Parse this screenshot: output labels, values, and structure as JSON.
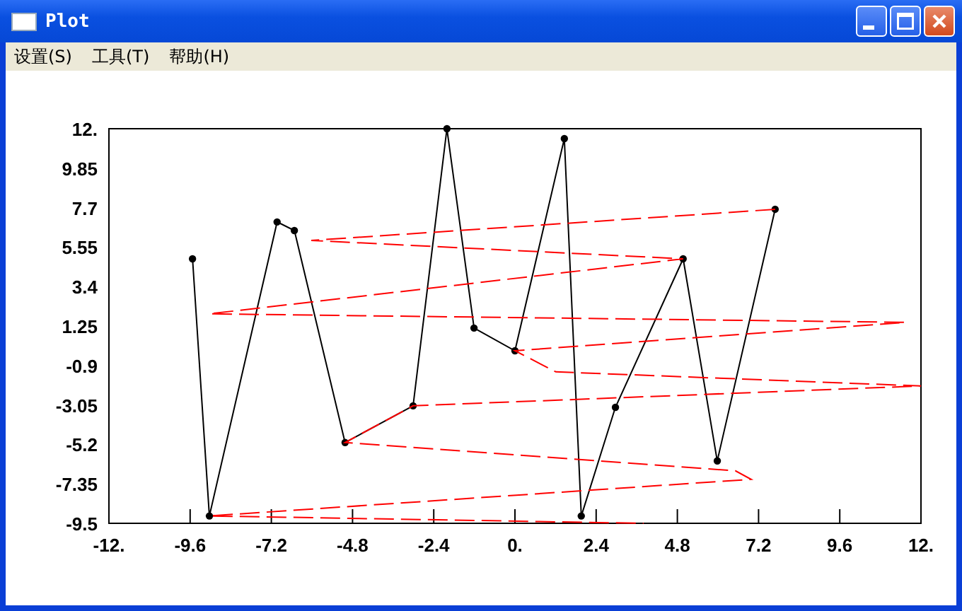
{
  "window": {
    "title": "Plot"
  },
  "menu": [
    {
      "label": "设置(S)"
    },
    {
      "label": "工具(T)"
    },
    {
      "label": "帮助(H)"
    }
  ],
  "plot": {
    "chart_data": {
      "type": "line",
      "xlim": [
        -12,
        12
      ],
      "ylim": [
        -9.5,
        12
      ],
      "xticks": [
        {
          "value": -12,
          "label": "-12."
        },
        {
          "value": -9.6,
          "label": "-9.6"
        },
        {
          "value": -7.2,
          "label": "-7.2"
        },
        {
          "value": -4.8,
          "label": "-4.8"
        },
        {
          "value": -2.4,
          "label": "-2.4"
        },
        {
          "value": 0,
          "label": "0."
        },
        {
          "value": 2.4,
          "label": "2.4"
        },
        {
          "value": 4.8,
          "label": "4.8"
        },
        {
          "value": 7.2,
          "label": "7.2"
        },
        {
          "value": 9.6,
          "label": "9.6"
        },
        {
          "value": 12,
          "label": "12."
        }
      ],
      "yticks": [
        {
          "value": 12,
          "label": "12."
        },
        {
          "value": 9.85,
          "label": "9.85"
        },
        {
          "value": 7.7,
          "label": "7.7"
        },
        {
          "value": 5.55,
          "label": "5.55"
        },
        {
          "value": 3.4,
          "label": "3.4"
        },
        {
          "value": 1.25,
          "label": "1.25"
        },
        {
          "value": -0.9,
          "label": "-0.9"
        },
        {
          "value": -3.05,
          "label": "-3.05"
        },
        {
          "value": -5.2,
          "label": "-5.2"
        },
        {
          "value": -7.35,
          "label": "-7.35"
        },
        {
          "value": -9.5,
          "label": "-9.5"
        }
      ],
      "series": [
        {
          "color": "#000000",
          "line_style": "solid",
          "marker": "circle",
          "x": [
            -9.53,
            -9.03,
            -7.03,
            -6.52,
            -5.02,
            -3.01,
            -2.01,
            -1.21,
            0,
            1.46,
            1.96,
            2.97,
            4.97,
            5.98,
            7.69
          ],
          "values": [
            4.91,
            -9.1,
            6.92,
            6.45,
            -5.1,
            -3.1,
            12,
            1.14,
            -0.1,
            11.46,
            -9.1,
            -3.18,
            4.91,
            -6.1,
            7.61
          ]
        },
        {
          "color": "#ff0000",
          "line_style": "dashed",
          "x": [
            7.69,
            -6.02,
            4.97,
            -9.03,
            11.54,
            0,
            1.21,
            12,
            -3.01,
            -5.02,
            6.52,
            6.98,
            -9.03,
            3.8
          ],
          "values": [
            7.61,
            5.91,
            4.91,
            1.91,
            1.45,
            -0.1,
            -1.25,
            -2.02,
            -3.1,
            -5.1,
            -6.64,
            -7.1,
            -9.1,
            -9.5
          ]
        }
      ]
    }
  }
}
